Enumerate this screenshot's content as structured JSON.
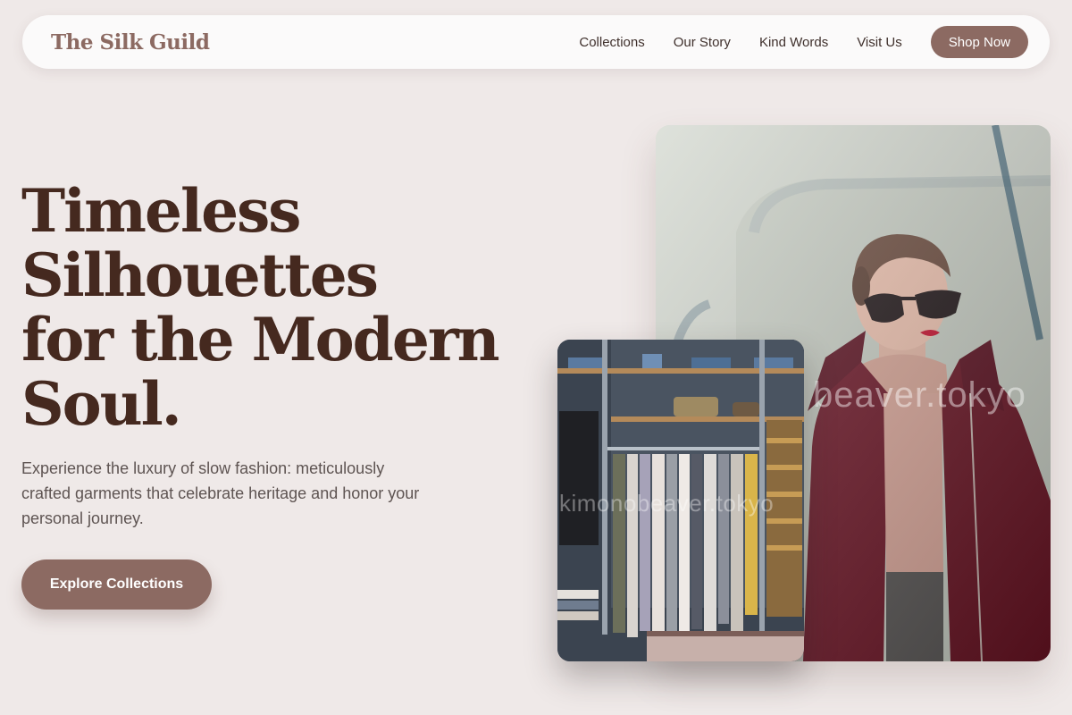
{
  "nav": {
    "brand": "The Silk Guild",
    "links": [
      "Collections",
      "Our Story",
      "Kind Words",
      "Visit Us"
    ],
    "cta": "Shop Now"
  },
  "hero": {
    "title_lines": [
      "Timeless",
      "Silhouettes",
      "for the Modern",
      "Soul."
    ],
    "description": "Experience the luxury of slow fashion: meticulously crafted garments that celebrate heritage and honor your personal journey.",
    "cta": "Explore Collections"
  },
  "images": {
    "main_watermark": "beaver.tokyo",
    "shop_watermark": "kimonobeaver.tokyo"
  },
  "colors": {
    "background": "#efe9e8",
    "accent": "#8c6a62",
    "title": "#45291f",
    "body_text": "#5e5452"
  }
}
